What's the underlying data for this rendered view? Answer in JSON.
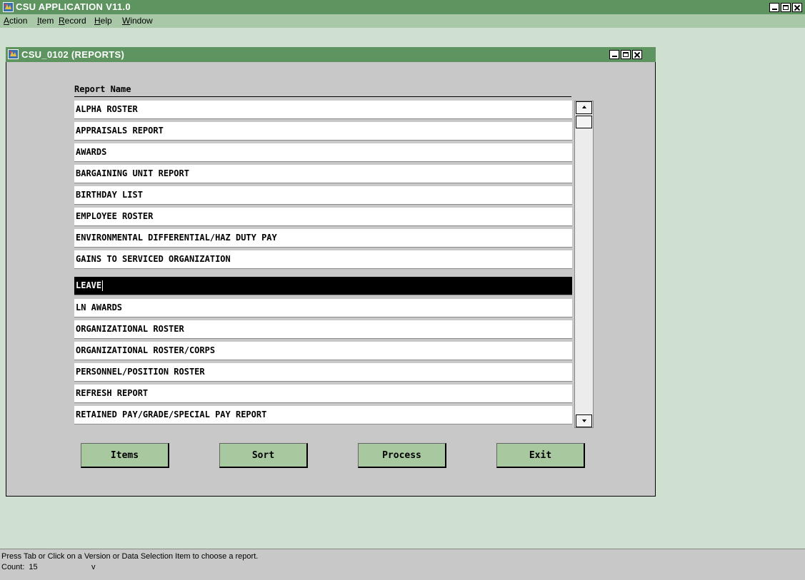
{
  "app": {
    "title": "CSU APPLICATION V11.0"
  },
  "menubar": {
    "items": [
      {
        "label": "Action",
        "mnemonic": "A"
      },
      {
        "label": "Item",
        "mnemonic": "I"
      },
      {
        "label": "Record",
        "mnemonic": "R"
      },
      {
        "label": "Help",
        "mnemonic": "H"
      },
      {
        "label": "Window",
        "mnemonic": "W"
      }
    ]
  },
  "form": {
    "title": "CSU_0102 (REPORTS)",
    "column_header": "Report Name",
    "rows": [
      "ALPHA ROSTER",
      "APPRAISALS REPORT",
      "AWARDS",
      "BARGAINING UNIT REPORT",
      "BIRTHDAY LIST",
      "EMPLOYEE ROSTER",
      "ENVIRONMENTAL DIFFERENTIAL/HAZ DUTY PAY",
      "GAINS TO SERVICED ORGANIZATION",
      "LEAVE",
      "LN AWARDS",
      "ORGANIZATIONAL ROSTER",
      "ORGANIZATIONAL ROSTER/CORPS",
      "PERSONNEL/POSITION ROSTER",
      "REFRESH REPORT",
      "RETAINED PAY/GRADE/SPECIAL PAY REPORT"
    ],
    "selected_row": "LEAVE"
  },
  "buttons": {
    "items": "Items",
    "sort": "Sort",
    "process": "Process",
    "exit": "Exit"
  },
  "status": {
    "message": "Press Tab or Click on a Version or Data Selection Item to choose a report.",
    "count_label": "Count:",
    "count_value": "15",
    "mode": "v"
  },
  "colors": {
    "title_bar": "#5e9460",
    "menu_bar": "#a8c8a8",
    "desktop": "#d0e0d0",
    "button": "#a8c8a0",
    "selected_row": "#000000"
  }
}
